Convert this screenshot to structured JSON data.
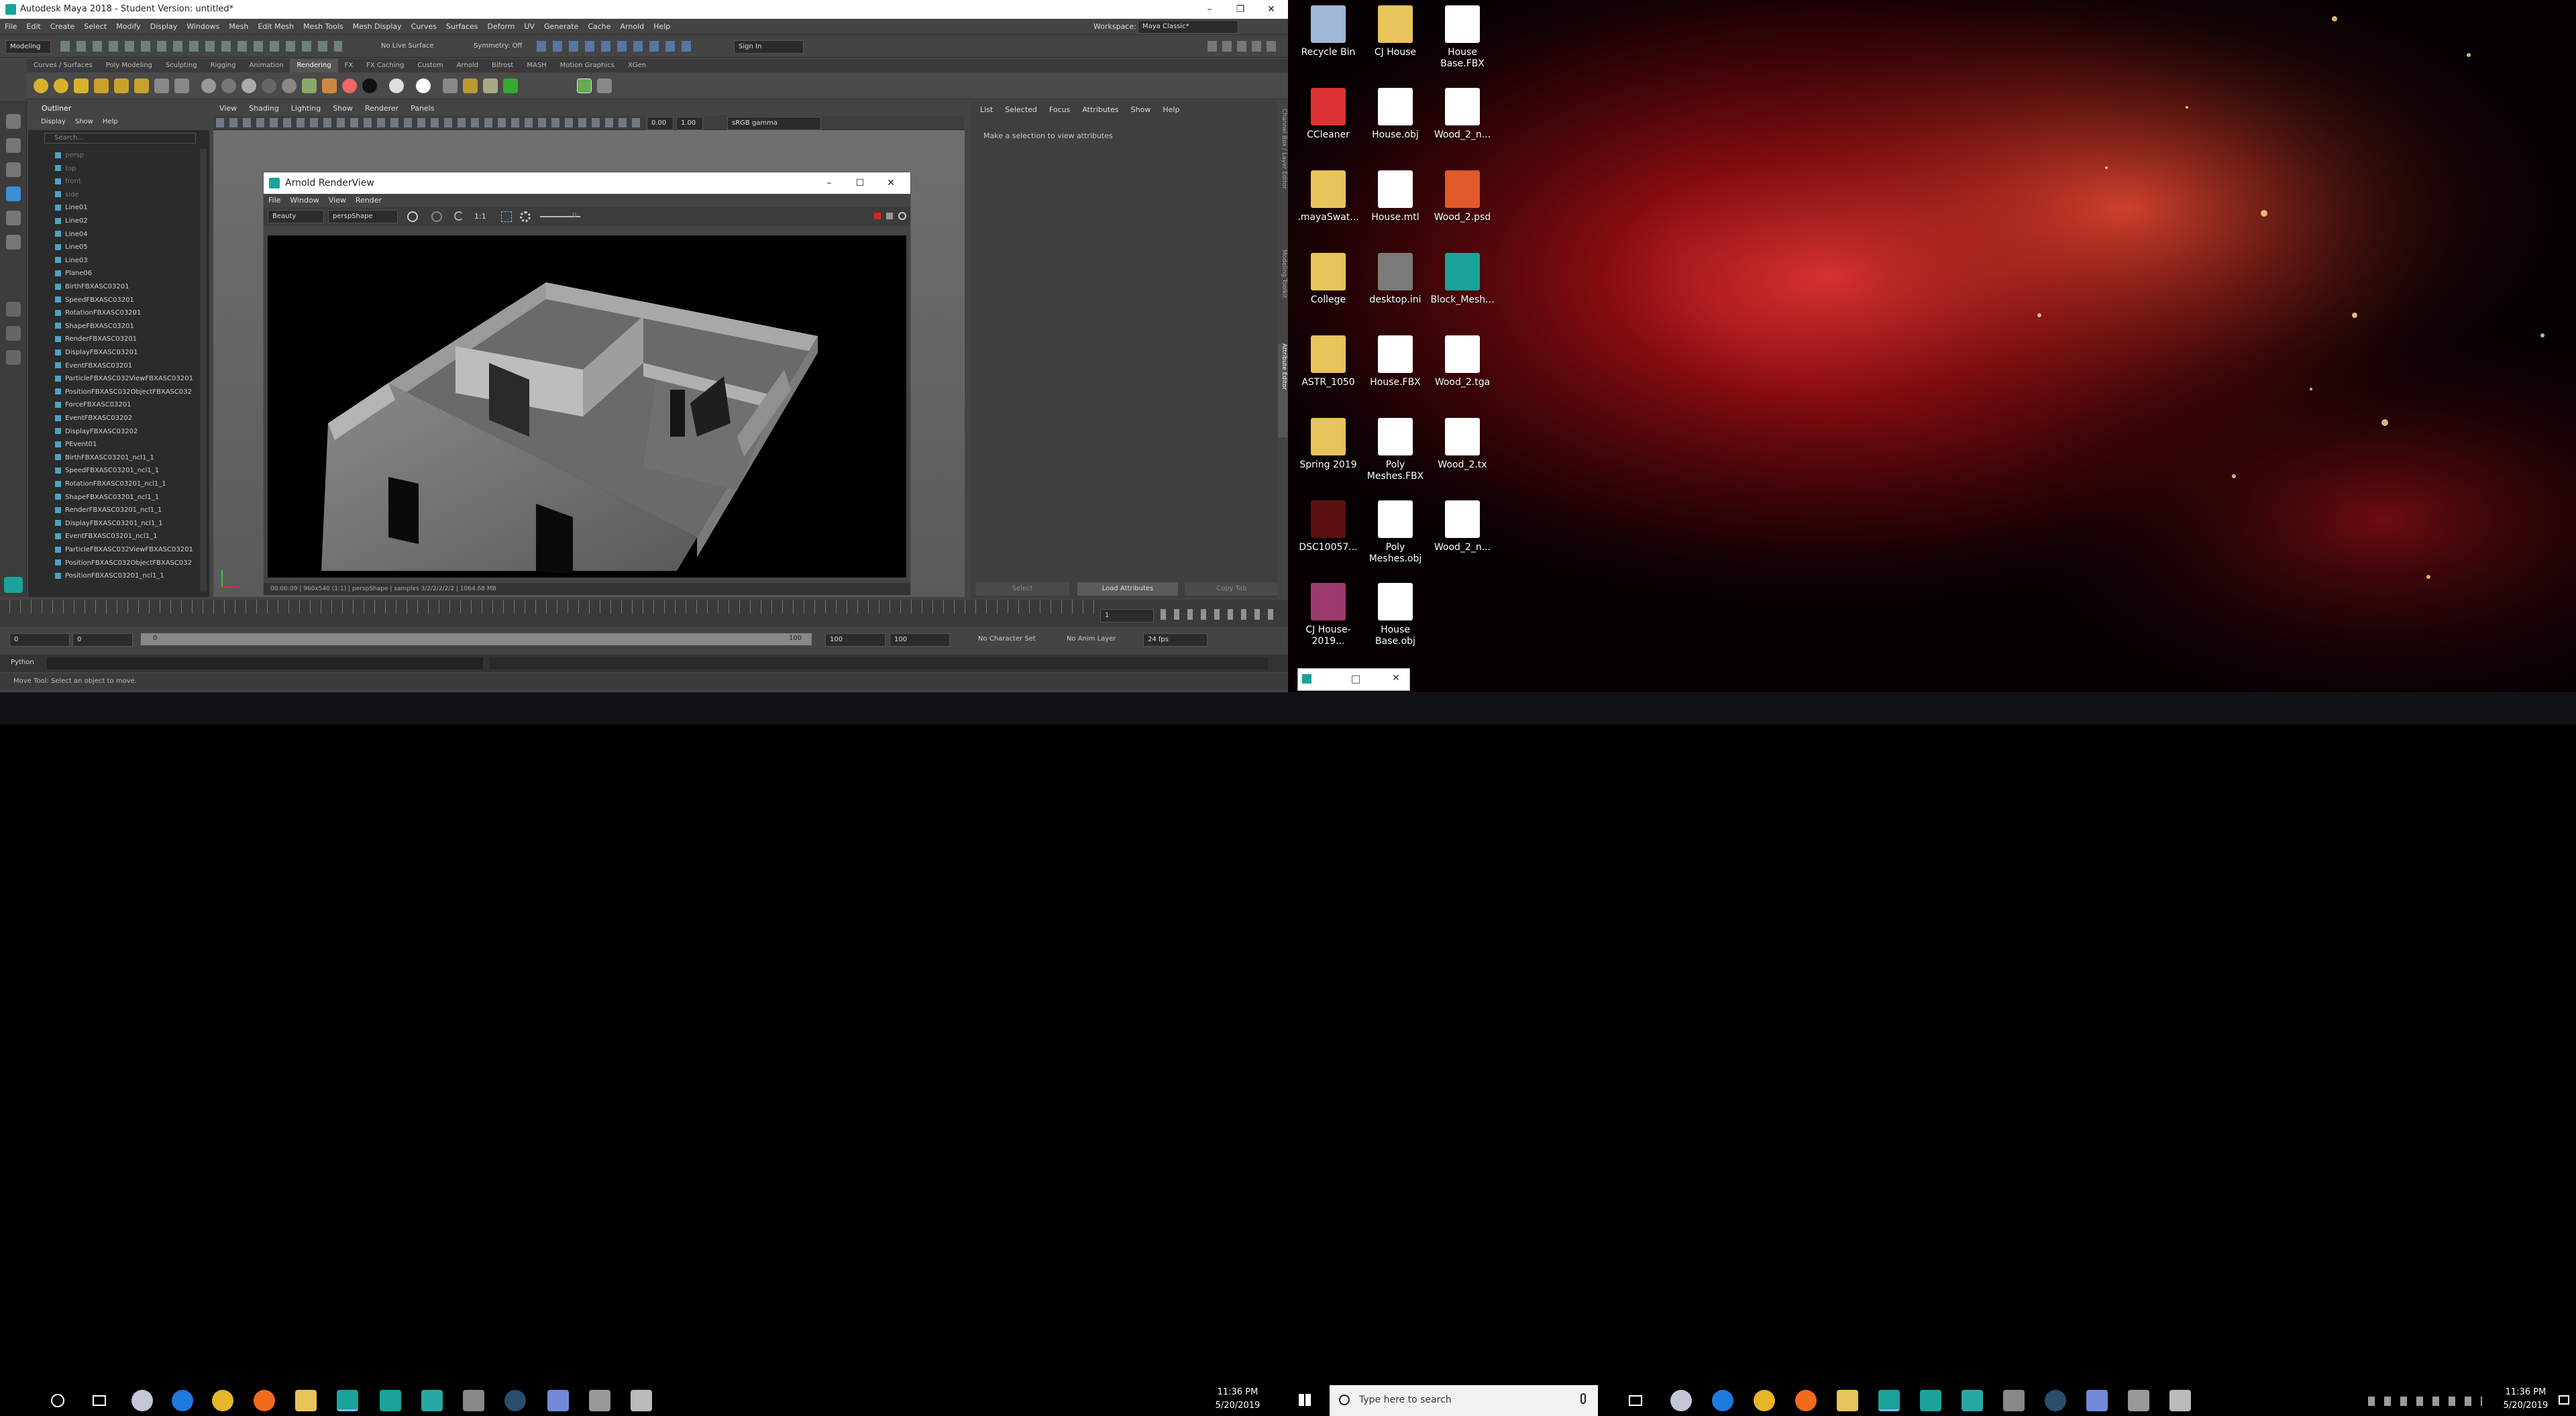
{
  "maya": {
    "title": "Autodesk Maya 2018 - Student Version: untitled*",
    "menu": [
      "File",
      "Edit",
      "Create",
      "Select",
      "Modify",
      "Display",
      "Windows",
      "Mesh",
      "Edit Mesh",
      "Mesh Tools",
      "Mesh Display",
      "Curves",
      "Surfaces",
      "Deform",
      "UV",
      "Generate",
      "Cache",
      "Arnold",
      "Help"
    ],
    "workspace_label": "Workspace:",
    "workspace_value": "Maya Classic*",
    "mode_select": "Modeling",
    "no_live_surface": "No Live Surface",
    "symmetry": "Symmetry: Off",
    "sign_in": "Sign In",
    "shelf_tabs": [
      "Curves / Surfaces",
      "Poly Modeling",
      "Sculpting",
      "Rigging",
      "Animation",
      "Rendering",
      "FX",
      "FX Caching",
      "Custom",
      "Arnold",
      "Bifrost",
      "MASH",
      "Motion Graphics",
      "XGen"
    ],
    "active_shelf_tab": "Rendering",
    "outliner": {
      "title": "Outliner",
      "menu": [
        "Display",
        "Show",
        "Help"
      ],
      "search_placeholder": "Search...",
      "rows": [
        "persp",
        "top",
        "front",
        "side",
        "Line01",
        "Line02",
        "Line04",
        "Line05",
        "Line03",
        "Plane06",
        "BirthFBXASC03201",
        "SpeedFBXASC03201",
        "RotationFBXASC03201",
        "ShapeFBXASC03201",
        "RenderFBXASC03201",
        "DisplayFBXASC03201",
        "EventFBXASC03201",
        "ParticleFBXASC032ViewFBXASC03201",
        "PositionFBXASC032ObjectFBXASC032",
        "ForceFBXASC03201",
        "EventFBXASC03202",
        "DisplayFBXASC03202",
        "PEvent01",
        "BirthFBXASC03201_ncl1_1",
        "SpeedFBXASC03201_ncl1_1",
        "RotationFBXASC03201_ncl1_1",
        "ShapeFBXASC03201_ncl1_1",
        "RenderFBXASC03201_ncl1_1",
        "DisplayFBXASC03201_ncl1_1",
        "EventFBXASC03201_ncl1_1",
        "ParticleFBXASC032ViewFBXASC03201",
        "PositionFBXASC032ObjectFBXASC032",
        "PositionFBXASC03201_ncl1_1"
      ]
    },
    "viewport_menu": [
      "View",
      "Shading",
      "Lighting",
      "Show",
      "Renderer",
      "Panels"
    ],
    "viewport_values": {
      "a": "0.00",
      "b": "1.00",
      "color_mgmt": "sRGB gamma"
    },
    "attr_menu": [
      "List",
      "Selected",
      "Focus",
      "Attributes",
      "Show",
      "Help"
    ],
    "attr_message": "Make a selection to view attributes",
    "attr_buttons": [
      "Select",
      "Load Attributes",
      "Copy Tab"
    ],
    "side_tabs": [
      "Channel Box / Layer Editor",
      "Modeling Toolkit",
      "Attribute Editor"
    ],
    "timeline_end": "1",
    "range": {
      "start": "0",
      "inner_start": "0",
      "current": "0",
      "inner_end": "100",
      "end_a": "100",
      "end_b": "100"
    },
    "no_character_set": "No Character Set",
    "no_anim_layer": "No Anim Layer",
    "fps": "24 fps",
    "cmd_label": "Python",
    "help_line": "Move Tool: Select an object to move."
  },
  "renderview": {
    "title": "Arnold RenderView",
    "menu": [
      "File",
      "Window",
      "View",
      "Render"
    ],
    "aov": "Beauty",
    "camera": "perspShape",
    "ratio": "1:1",
    "exposure": "0",
    "status": "00:00:09 | 960x540 (1:1) | perspShape | samples 3/2/2/2/2/2 | 1064.68 MB"
  },
  "desktop": {
    "icons": [
      {
        "label": "Recycle Bin",
        "color": "#9fb8d6"
      },
      {
        "label": "CJ House",
        "color": "#e8c45a"
      },
      {
        "label": "House Base.FBX",
        "color": "#ffffff"
      },
      {
        "label": "CCleaner",
        "color": "#d33"
      },
      {
        "label": "House.obj",
        "color": "#ffffff"
      },
      {
        "label": "Wood_2_n...",
        "color": "#ffffff"
      },
      {
        "label": ".mayaSwat...",
        "color": "#e8c45a"
      },
      {
        "label": "House.mtl",
        "color": "#ffffff"
      },
      {
        "label": "Wood_2.psd",
        "color": "#e05a2a"
      },
      {
        "label": "College",
        "color": "#e8c45a"
      },
      {
        "label": "desktop.ini",
        "color": "#7a7a7a"
      },
      {
        "label": "Block_Mesh...",
        "color": "#1aa39a"
      },
      {
        "label": "ASTR_1050",
        "color": "#e8c45a"
      },
      {
        "label": "House.FBX",
        "color": "#ffffff"
      },
      {
        "label": "Wood_2.tga",
        "color": "#ffffff"
      },
      {
        "label": "Spring 2019",
        "color": "#e8c45a"
      },
      {
        "label": "Poly Meshes.FBX",
        "color": "#ffffff"
      },
      {
        "label": "Wood_2.tx",
        "color": "#ffffff"
      },
      {
        "label": "DSC10057...",
        "color": "#5a1010"
      },
      {
        "label": "Poly Meshes.obj",
        "color": "#ffffff"
      },
      {
        "label": "Wood_2_n...",
        "color": "#ffffff"
      },
      {
        "label": "CJ House-2019...",
        "color": "#9c3a6e"
      },
      {
        "label": "House Base.obj",
        "color": "#ffffff"
      }
    ],
    "search_placeholder": "Type here to search"
  },
  "taskbar_left": {
    "time": "11:36 PM",
    "date": "5/20/2019"
  },
  "taskbar_right": {
    "time": "11:36 PM",
    "date": "5/20/2019"
  }
}
